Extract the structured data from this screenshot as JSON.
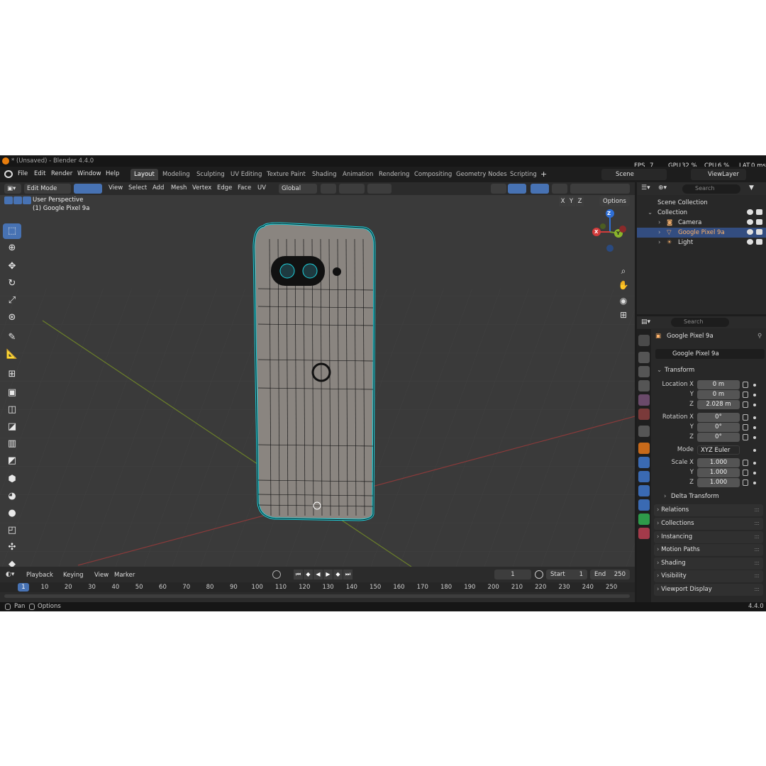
{
  "title_bar": {
    "title": "* (Unsaved) - Blender 4.4.0",
    "fps_label": "FPS",
    "fps_value": "7",
    "gpu_label": "GPU",
    "gpu_value": "32 %",
    "cpu_label": "CPU",
    "cpu_value": "6 %",
    "lat_label": "LAT",
    "lat_value": "0 ms"
  },
  "menu": [
    "File",
    "Edit",
    "Render",
    "Window",
    "Help"
  ],
  "workspaces": [
    "Layout",
    "Modeling",
    "Sculpting",
    "UV Editing",
    "Texture Paint",
    "Shading",
    "Animation",
    "Rendering",
    "Compositing",
    "Geometry Nodes",
    "Scripting"
  ],
  "add_workspace": "+",
  "scene": "Scene",
  "view_layer": "ViewLayer",
  "viewport": {
    "mode": "Edit Mode",
    "menus": [
      "View",
      "Select",
      "Add",
      "Mesh",
      "Vertex",
      "Edge",
      "Face",
      "UV"
    ],
    "orientation": "Global",
    "options": "Options",
    "axis_x": "X",
    "axis_y": "Y",
    "axis_z": "Z",
    "perspective": "User Perspective",
    "object_info": "(1) Google Pixel 9a",
    "gizmo": {
      "x": "X",
      "y": "Y",
      "z": "Z"
    }
  },
  "tools": [
    "select-box",
    "cursor",
    "move",
    "rotate",
    "scale",
    "transform",
    "annotate",
    "measure",
    "add-cube",
    "extrude",
    "inset",
    "bevel",
    "loop-cut",
    "knife",
    "poly-build",
    "spin",
    "smooth",
    "shrink-fatten",
    "shear",
    "rip"
  ],
  "outliner": {
    "search_placeholder": "Search",
    "scene_collection": "Scene Collection",
    "collection": "Collection",
    "items": [
      {
        "label": "Camera",
        "selected": false
      },
      {
        "label": "Google Pixel 9a",
        "selected": true
      },
      {
        "label": "Light",
        "selected": false
      }
    ]
  },
  "properties": {
    "search_placeholder": "Search",
    "object_name": "Google Pixel 9a",
    "object_field": "Google Pixel 9a",
    "transform_header": "Transform",
    "location_label": "Location X",
    "y_label": "Y",
    "z_label": "Z",
    "location": [
      "0 m",
      "0 m",
      "2.028 m"
    ],
    "rotation_label": "Rotation X",
    "rotation": [
      "0°",
      "0°",
      "0°"
    ],
    "mode_label": "Mode",
    "mode_value": "XYZ Euler",
    "scale_label": "Scale X",
    "scale": [
      "1.000",
      "1.000",
      "1.000"
    ],
    "delta_transform": "Delta Transform",
    "panels": [
      "Relations",
      "Collections",
      "Instancing",
      "Motion Paths",
      "Shading",
      "Visibility",
      "Viewport Display"
    ]
  },
  "timeline": {
    "menus": [
      "Playback",
      "Keying",
      "View",
      "Marker"
    ],
    "current_frame": "1",
    "start_label": "Start",
    "start_value": "1",
    "end_label": "End",
    "end_value": "250",
    "ruler_current": "1",
    "ruler_ticks": [
      "10",
      "20",
      "30",
      "40",
      "50",
      "60",
      "70",
      "80",
      "90",
      "100",
      "110",
      "120",
      "130",
      "140",
      "150",
      "160",
      "170",
      "180",
      "190",
      "200",
      "210",
      "220",
      "230",
      "240",
      "250"
    ]
  },
  "status_bar": {
    "pan": "Pan",
    "options": "Options",
    "version": "4.4.0"
  },
  "colors": {
    "accent": "#4772b3",
    "selected_row": "#334d80",
    "mesh_edge": "#1ed5e0",
    "object_orange": "#e87d0d"
  }
}
